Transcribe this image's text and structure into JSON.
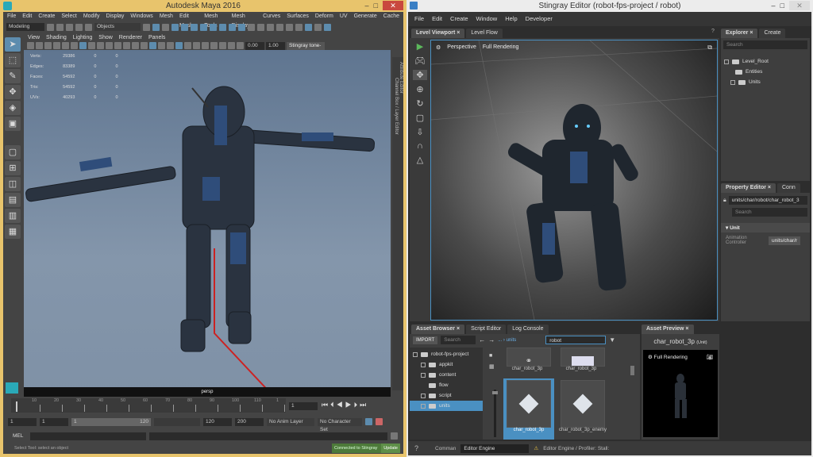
{
  "maya": {
    "title": "Autodesk Maya 2016",
    "menu": [
      "File",
      "Edit",
      "Create",
      "Select",
      "Modify",
      "Display",
      "Windows",
      "Mesh",
      "Edit Mesh",
      "Mesh Tools",
      "Mesh Display",
      "Curves",
      "Surfaces",
      "Deform",
      "UV",
      "Generate",
      "Cache"
    ],
    "mode": "Modeling",
    "objects": "Objects",
    "panel_menu": [
      "View",
      "Shading",
      "Lighting",
      "Show",
      "Renderer",
      "Panels"
    ],
    "exposure": "0.00",
    "gamma": "1.00",
    "tone": "Stingray tone-m",
    "stats": [
      [
        "Verts:",
        "29386",
        "0",
        "0"
      ],
      [
        "Edges:",
        "83389",
        "0",
        "0"
      ],
      [
        "Faces:",
        "54592",
        "0",
        "0"
      ],
      [
        "Tris:",
        "54592",
        "0",
        "0"
      ],
      [
        "UVs:",
        "40293",
        "0",
        "0"
      ]
    ],
    "camera": "persp",
    "side_tabs": [
      "Attribute Editor",
      "Channel Box / Layer Editor"
    ],
    "timeline_ticks": [
      "10",
      "20",
      "30",
      "40",
      "50",
      "60",
      "70",
      "80",
      "90",
      "100",
      "110",
      "1"
    ],
    "current_frame": "1",
    "range": {
      "start": "1",
      "play_start": "1",
      "slider_start": "1",
      "slider_end": "120",
      "play_end": "120",
      "end": "200"
    },
    "anim_layer": "No Anim Layer",
    "char_set": "No Character Set",
    "mel": "MEL",
    "status": "Select Tool: select an object",
    "connected": "Connected to Stingray",
    "update": "Update"
  },
  "stingray": {
    "title": "Stingray Editor (robot-fps-project / robot)",
    "menu": [
      "File",
      "Edit",
      "Create",
      "Window",
      "Help",
      "Developer"
    ],
    "tabs": [
      "Level Viewport",
      "Level Flow"
    ],
    "viewport": {
      "camera": "Perspective",
      "mode": "Full Rendering"
    },
    "explorer": {
      "tabs": [
        "Explorer",
        "Create"
      ],
      "search": "Search",
      "tree": [
        "Level_Root",
        "Entities",
        "Units"
      ]
    },
    "property": {
      "tabs": [
        "Property Editor",
        "Conn"
      ],
      "path": "units/char/robot/char_robot_3",
      "search": "Search",
      "section": "Unit",
      "label": "Animation Controller",
      "value": "units/char/r"
    },
    "assets": {
      "tabs": [
        "Asset Browser",
        "Script Editor",
        "Log Console"
      ],
      "import": "IMPORT",
      "search": "Search",
      "crumb": "... › units",
      "filter": "robot",
      "tree": [
        "robot-fps-project",
        "appkit",
        "content",
        "flow",
        "script",
        "units"
      ],
      "items": [
        "char_robot_3p",
        "char_robot_3p",
        "char_robot_3p",
        "char_robot_3p_enemy"
      ]
    },
    "preview": {
      "tab": "Asset Preview",
      "name": "char_robot_3p",
      "type": "(Unit)",
      "mode": "Full Rendering"
    },
    "status": {
      "command": "Comman",
      "engine": "Editor Engine",
      "message": "Editor Engine / Profiler: Stall:"
    },
    "accent": "#4a90c2"
  }
}
